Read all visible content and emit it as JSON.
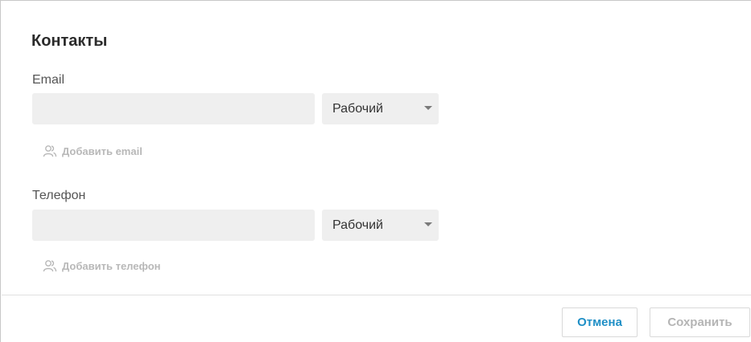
{
  "form": {
    "title": "Контакты",
    "email": {
      "label": "Email",
      "value": "",
      "type_selected": "Рабочий",
      "add_label": "Добавить email"
    },
    "phone": {
      "label": "Телефон",
      "value": "",
      "type_selected": "Рабочий",
      "add_label": "Добавить телефон"
    }
  },
  "footer": {
    "cancel_label": "Отмена",
    "save_label": "Сохранить"
  },
  "colors": {
    "accent": "#1f8fc6",
    "disabled_text": "#b5b5b5",
    "input_bg": "#efefef"
  },
  "icons": {
    "add_email": "users-icon",
    "add_phone": "users-icon",
    "select_caret": "caret-down-icon"
  }
}
